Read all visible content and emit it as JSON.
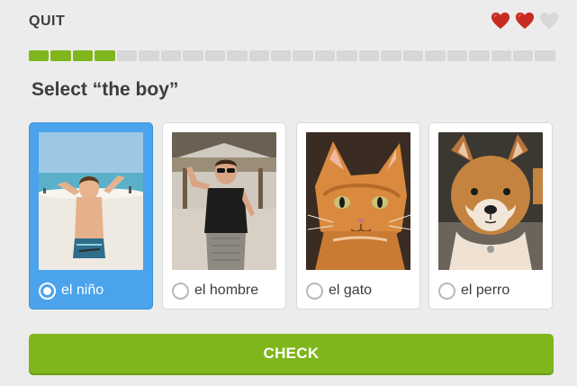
{
  "header": {
    "quit_label": "QUIT",
    "hearts": [
      {
        "name": "heart-full",
        "color": "#c82b1f"
      },
      {
        "name": "heart-full",
        "color": "#c82b1f"
      },
      {
        "name": "heart-empty",
        "color": "#d8d8d8"
      }
    ]
  },
  "progress": {
    "completed": 4,
    "total": 24,
    "color_done": "#7fb61d",
    "color_todo": "#d7d7d7"
  },
  "prompt": "Select “the boy”",
  "options": [
    {
      "label": "el niño",
      "image": "boy-at-beach",
      "selected": true
    },
    {
      "label": "el hombre",
      "image": "man-in-sunglasses",
      "selected": false
    },
    {
      "label": "el gato",
      "image": "orange-cat",
      "selected": false
    },
    {
      "label": "el perro",
      "image": "shiba-dog",
      "selected": false
    }
  ],
  "check_button": {
    "label": "CHECK",
    "color": "#7fb61d"
  },
  "colors": {
    "background": "#ececec",
    "selected_card": "#4ba3eb"
  }
}
